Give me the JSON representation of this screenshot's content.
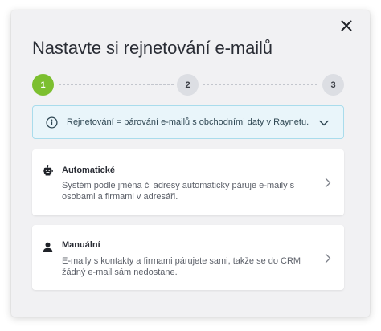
{
  "modal": {
    "title": "Nastavte si rejnetování e-mailů",
    "close_icon": "close-icon"
  },
  "stepper": {
    "steps": [
      {
        "label": "1",
        "state": "active"
      },
      {
        "label": "2",
        "state": "inactive"
      },
      {
        "label": "3",
        "state": "inactive"
      }
    ],
    "active_color": "#7cbf2f",
    "inactive_color": "#dcdee3"
  },
  "info": {
    "text": "Rejnetování = párování e-mailů s obchodními daty v Raynetu.",
    "icon": "info-icon",
    "toggle_icon": "chevron-down-icon",
    "background": "#e9f5fa",
    "border": "#a9dcec"
  },
  "options": [
    {
      "title": "Automatické",
      "description": "Systém podle jména či adresy automaticky páruje e-maily s osobami a firmami v adresáři.",
      "icon": "robot-icon"
    },
    {
      "title": "Manuální",
      "description": "E-maily s kontakty a firmami párujete sami, takže se do CRM žádný e-mail sám nedostane.",
      "icon": "person-icon"
    }
  ]
}
